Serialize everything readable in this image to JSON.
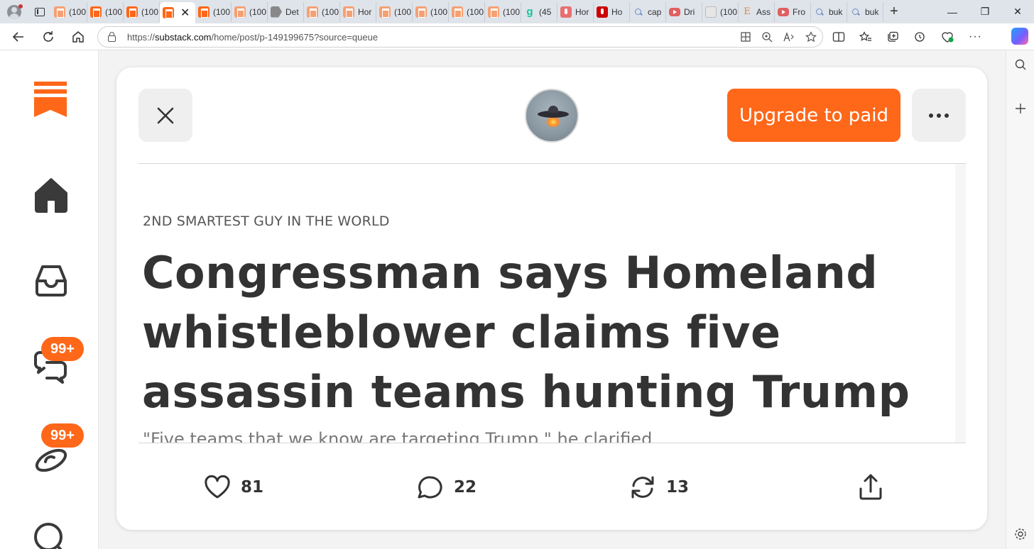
{
  "browser": {
    "tabs": [
      {
        "title": "(100",
        "icon": "substack"
      },
      {
        "title": "(100",
        "icon": "substack-dark"
      },
      {
        "title": "(100",
        "icon": "substack-dark"
      },
      {
        "title": "",
        "icon": "substack-dark",
        "active": true
      },
      {
        "title": "(100",
        "icon": "substack-dark"
      },
      {
        "title": "(100",
        "icon": "substack"
      },
      {
        "title": "Det",
        "icon": "gray"
      },
      {
        "title": "(100",
        "icon": "substack"
      },
      {
        "title": "Hor",
        "icon": "substack"
      },
      {
        "title": "(100",
        "icon": "substack"
      },
      {
        "title": "(100",
        "icon": "substack"
      },
      {
        "title": "(100",
        "icon": "substack"
      },
      {
        "title": "(100",
        "icon": "substack"
      },
      {
        "title": "(45",
        "icon": "green"
      },
      {
        "title": "Hor",
        "icon": "redmic"
      },
      {
        "title": "Ho",
        "icon": "red"
      },
      {
        "title": "cap",
        "icon": "search"
      },
      {
        "title": "Dri",
        "icon": "yt"
      },
      {
        "title": "(100",
        "icon": "blank"
      },
      {
        "title": "Ass",
        "icon": "letter"
      },
      {
        "title": "Fro",
        "icon": "yt"
      },
      {
        "title": "buk",
        "icon": "search"
      },
      {
        "title": "buk",
        "icon": "search"
      }
    ],
    "active_tab_close": "✕",
    "new_tab": "+",
    "window_controls": {
      "minimize": "—",
      "restore": "❐",
      "close": "✕"
    },
    "url_host_prefix": "https://",
    "url_host": "substack.com",
    "url_path": "/home/post/p-149199675?source=queue",
    "url_icons": [
      "app-available-icon",
      "zoom-icon",
      "read-aloud-icon",
      "favorite-star-icon"
    ],
    "toolbar_icons": [
      "split-screen-icon",
      "favorites-icon",
      "collections-icon",
      "history-icon",
      "browser-essentials-icon",
      "more-icon"
    ],
    "sidebar_icons": [
      "search-icon",
      "add-icon",
      "settings-icon"
    ]
  },
  "leftnav": {
    "items": [
      {
        "name": "home",
        "icon": "home-icon"
      },
      {
        "name": "inbox",
        "icon": "inbox-icon"
      },
      {
        "name": "chat",
        "icon": "chat-icon",
        "badge": "99+"
      },
      {
        "name": "activity",
        "icon": "activity-icon",
        "badge": "99+"
      },
      {
        "name": "search",
        "icon": "search-icon"
      }
    ],
    "accent": "#ff6719"
  },
  "post": {
    "upgrade_label": "Upgrade to paid",
    "publication": "2ND SMARTEST GUY IN THE WORLD",
    "title": "Congressman says Homeland whistleblower claims five assassin teams hunting Trump",
    "subtitle": "\"Five teams that we know are targeting Trump,\" he clarified.",
    "stats": {
      "likes": "81",
      "comments": "22",
      "restacks": "13"
    }
  },
  "colors": {
    "accent": "#ff6719",
    "text": "#333333",
    "muted": "#777777"
  }
}
